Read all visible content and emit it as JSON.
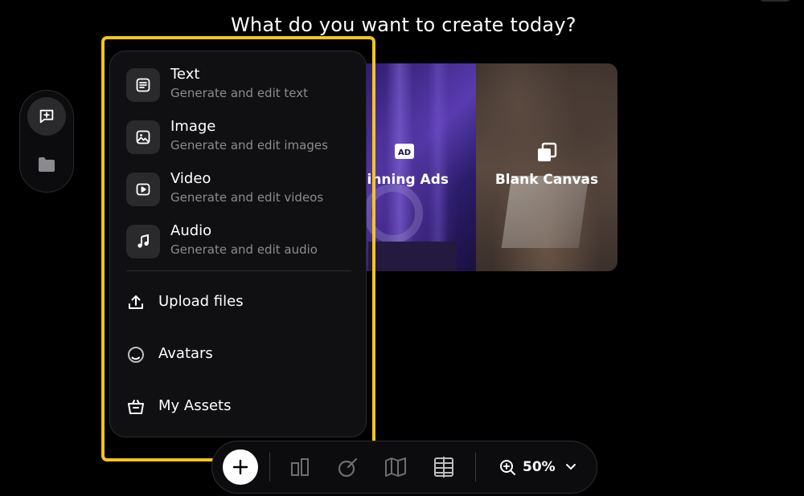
{
  "page": {
    "heading": "What do you want to create today?"
  },
  "cards": [
    {
      "label": "Winning Ads",
      "badge": "AD",
      "icon": "ad-icon"
    },
    {
      "label": "Blank Canvas",
      "icon": "copy-squares-icon"
    }
  ],
  "menu": {
    "items": [
      {
        "title": "Text",
        "subtitle": "Generate and edit text",
        "icon": "text-lines-icon"
      },
      {
        "title": "Image",
        "subtitle": "Generate and edit images",
        "icon": "image-icon"
      },
      {
        "title": "Video",
        "subtitle": "Generate and edit videos",
        "icon": "video-play-icon"
      },
      {
        "title": "Audio",
        "subtitle": "Generate and edit audio",
        "icon": "music-note-icon"
      }
    ],
    "actions": [
      {
        "label": "Upload files",
        "icon": "upload-icon"
      },
      {
        "label": "Avatars",
        "icon": "avatar-ring-icon"
      },
      {
        "label": "My Assets",
        "icon": "basket-icon"
      }
    ]
  },
  "toolbar": {
    "zoom": "50%"
  },
  "colors": {
    "background": "#000000",
    "panel": "#101012",
    "highlight": "#f5c518",
    "muted_text": "#8c8c90",
    "card_purple": "#4a2f93"
  }
}
